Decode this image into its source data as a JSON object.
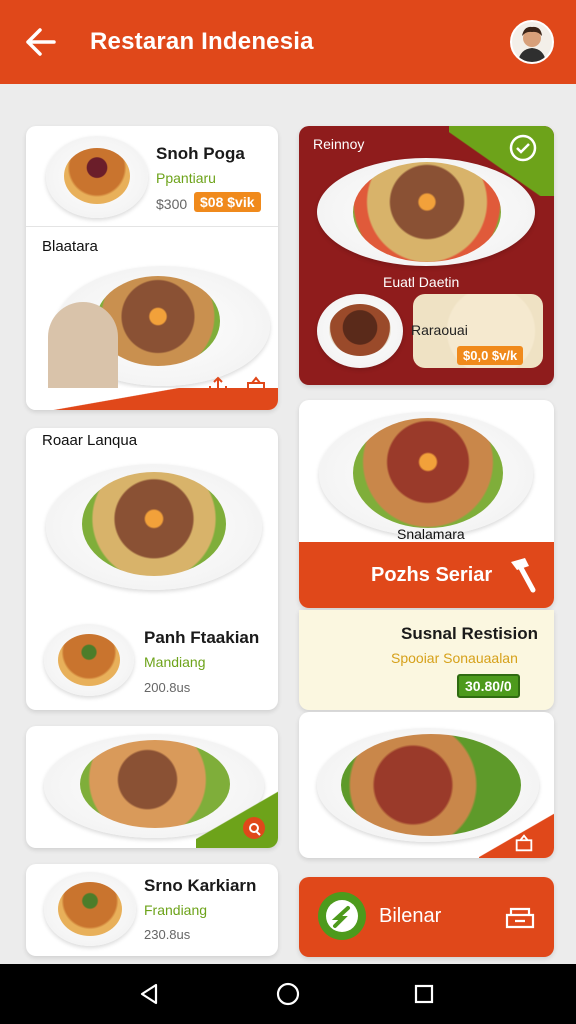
{
  "appbar": {
    "title": "Restaran Indenesia",
    "back_icon": "arrow-left-icon",
    "avatar_icon": "user-avatar-icon"
  },
  "left_column": {
    "card1": {
      "name": "Snoh Poga",
      "subtitle": "Ppantiaru",
      "old_price": "$300",
      "price": "$08 $vik",
      "section_title": "Blaatara"
    },
    "card2": {
      "title": "Roaar Lanqua",
      "name": "Panh Ftaakian",
      "subtitle": "Mandiang",
      "meta": "200.8us"
    },
    "card4": {
      "name": "Srno Karkiarn",
      "subtitle": "Frandiang",
      "meta": "230.8us"
    }
  },
  "right_column": {
    "promo": {
      "tag": "Reinnoy",
      "dish_label": "Euatl Daetin",
      "side_label": "Raraouai",
      "price": "$0,0 $v/k"
    },
    "dish": {
      "label": "Snalamara",
      "button": "Pozhs Seriar"
    },
    "info": {
      "name": "Susnal Restision",
      "subtitle": "Spooiar Sonauaalan",
      "price": "30.80/0"
    },
    "action": {
      "label": "Bilenar"
    }
  },
  "system_nav": {
    "back": "back-triangle-icon",
    "home": "home-circle-icon",
    "recent": "recent-square-icon"
  },
  "colors": {
    "primary": "#e0481a",
    "green": "#6da31a",
    "maroon": "#8f1c1c",
    "orange_badge": "#f08a1c",
    "cream": "#fbf7e0"
  }
}
